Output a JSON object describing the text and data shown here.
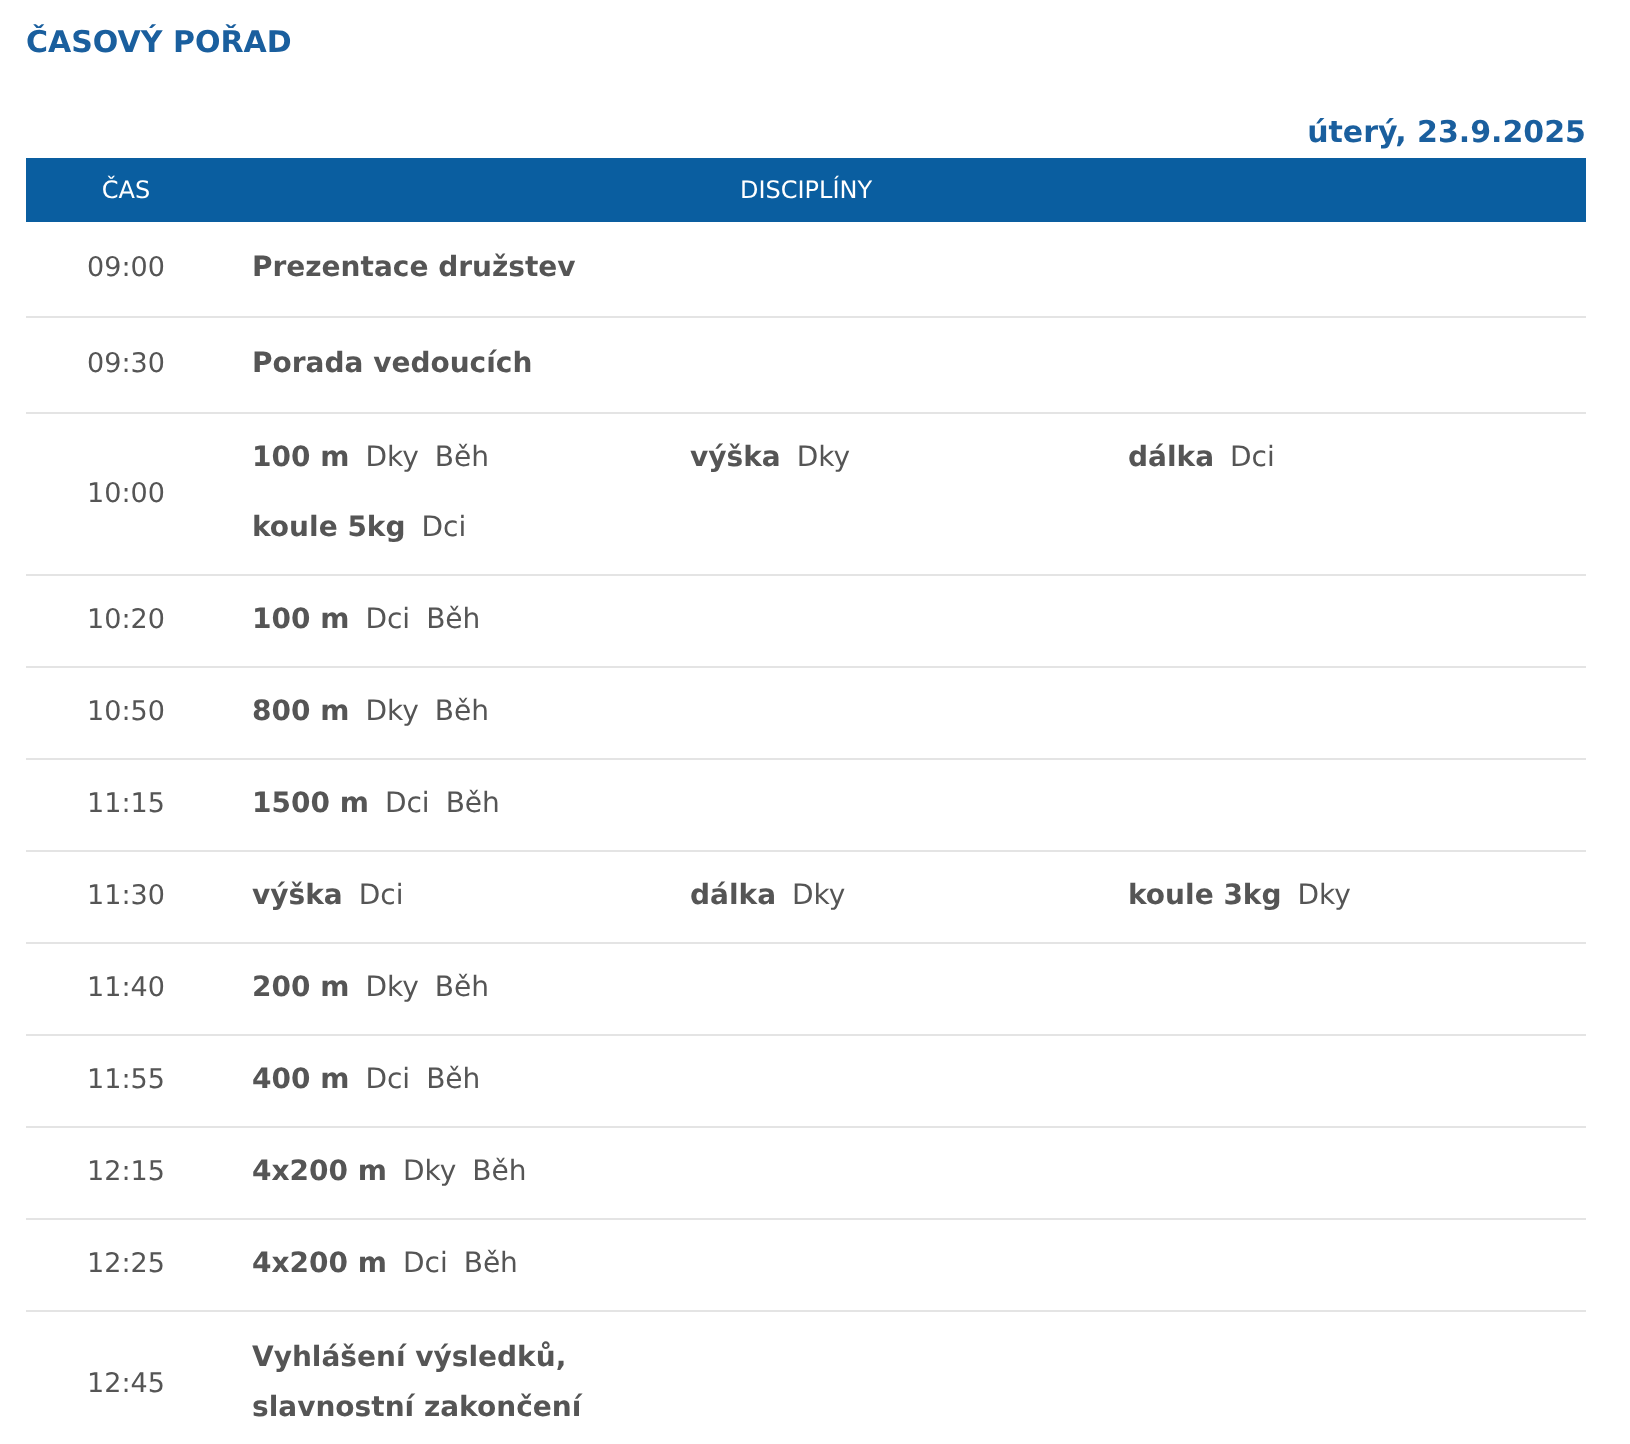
{
  "title": "ČASOVÝ POŘAD",
  "date": "úterý, 23.9.2025",
  "columns": [
    "ČAS",
    "DISCIPLÍNY"
  ],
  "rows": [
    {
      "time": "09:00",
      "items": [
        {
          "kind": "text",
          "text": "Prezentace družstev"
        }
      ]
    },
    {
      "time": "09:30",
      "items": [
        {
          "kind": "text",
          "text": "Porada vedoucích"
        }
      ]
    },
    {
      "time": "10:00",
      "items": [
        {
          "kind": "discipline",
          "name": "100 m",
          "category": "Dky",
          "type": "Běh"
        },
        {
          "kind": "discipline",
          "name": "výška",
          "category": "Dky"
        },
        {
          "kind": "discipline",
          "name": "dálka",
          "category": "Dci"
        },
        {
          "kind": "discipline",
          "name": "koule 5kg",
          "category": "Dci"
        }
      ]
    },
    {
      "time": "10:20",
      "items": [
        {
          "kind": "discipline",
          "name": "100 m",
          "category": "Dci",
          "type": "Běh"
        }
      ]
    },
    {
      "time": "10:50",
      "items": [
        {
          "kind": "discipline",
          "name": "800 m",
          "category": "Dky",
          "type": "Běh"
        }
      ]
    },
    {
      "time": "11:15",
      "items": [
        {
          "kind": "discipline",
          "name": "1500 m",
          "category": "Dci",
          "type": "Běh"
        }
      ]
    },
    {
      "time": "11:30",
      "items": [
        {
          "kind": "discipline",
          "name": "výška",
          "category": "Dci"
        },
        {
          "kind": "discipline",
          "name": "dálka",
          "category": "Dky"
        },
        {
          "kind": "discipline",
          "name": "koule 3kg",
          "category": "Dky"
        }
      ]
    },
    {
      "time": "11:40",
      "items": [
        {
          "kind": "discipline",
          "name": "200 m",
          "category": "Dky",
          "type": "Běh"
        }
      ]
    },
    {
      "time": "11:55",
      "items": [
        {
          "kind": "discipline",
          "name": "400 m",
          "category": "Dci",
          "type": "Běh"
        }
      ]
    },
    {
      "time": "12:15",
      "items": [
        {
          "kind": "discipline",
          "name": "4x200 m",
          "category": "Dky",
          "type": "Běh"
        }
      ]
    },
    {
      "time": "12:25",
      "items": [
        {
          "kind": "discipline",
          "name": "4x200 m",
          "category": "Dci",
          "type": "Běh"
        }
      ]
    },
    {
      "time": "12:45",
      "items": [
        {
          "kind": "text",
          "text": "Vyhlášení výsledků,\nslavnostní zakončení"
        }
      ]
    }
  ]
}
